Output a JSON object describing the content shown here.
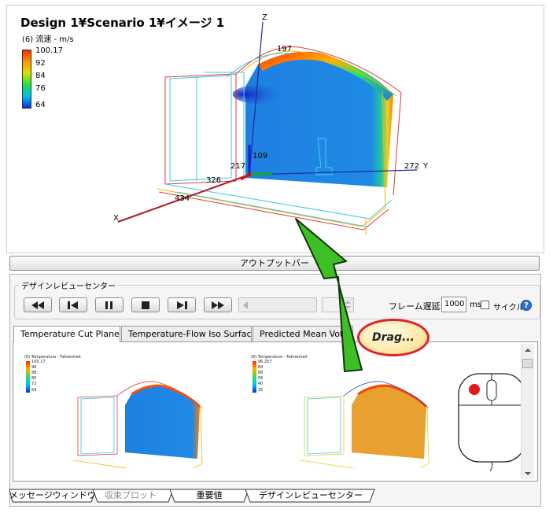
{
  "viewport": {
    "title": "Design 1¥Scenario 1¥イメージ 1",
    "result_label": "(6) 流速 - m/s",
    "legend_ticks": [
      "100.17",
      "92",
      "84",
      "76",
      "64"
    ],
    "axis_labels": {
      "z": "Z",
      "y": "Y",
      "x": "X"
    },
    "dimension_labels": [
      "197",
      "109",
      "217",
      "272",
      "326",
      "434"
    ]
  },
  "output_bar": {
    "label": "アウトプットバー"
  },
  "review_center": {
    "group_title": "デザインレビューセンター",
    "controls": [
      {
        "name": "rewind-icon"
      },
      {
        "name": "step-back-icon"
      },
      {
        "name": "pause-icon"
      },
      {
        "name": "stop-icon"
      },
      {
        "name": "step-forward-icon"
      },
      {
        "name": "fast-forward-icon"
      }
    ],
    "frame_delay_label": "フレーム遅延:",
    "frame_delay_value": "1000",
    "ms_label": "ms",
    "cycle_label": "サイクル",
    "help_icon": "?",
    "tabs": [
      {
        "label": "Temperature Cut Plane",
        "active": true
      },
      {
        "label": "Temperature-Flow Iso Surface",
        "active": false
      },
      {
        "label": "Predicted Mean Vote",
        "active": false
      }
    ],
    "thumbnails": [
      {
        "title": "(6) Temperature - Fahrenheit",
        "ticks": [
          "100.17",
          "96",
          "88",
          "80",
          "72",
          "64"
        ]
      },
      {
        "title": "(6) Temperature - Fahrenheit",
        "ticks": [
          "96.257",
          "84",
          "68",
          "56",
          "40",
          "25"
        ]
      }
    ]
  },
  "bottom_tabs": [
    {
      "label": "メッセージウィンドウ",
      "active": false
    },
    {
      "label": "収束プロット",
      "active": false
    },
    {
      "label": "重要値",
      "active": false
    },
    {
      "label": "デザインレビューセンター",
      "active": true
    }
  ],
  "callout": {
    "text": "Drag..."
  },
  "colors": {
    "arrow": "#3fbf26",
    "callout_border": "#e0202a",
    "help": "#2a6fd6"
  }
}
